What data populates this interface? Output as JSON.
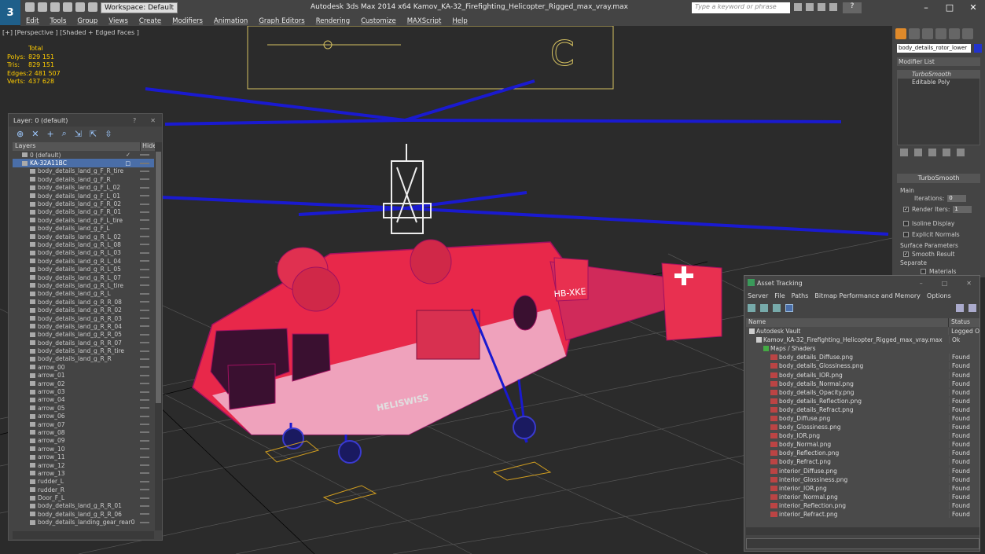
{
  "app": {
    "logo": "3",
    "workspace": "Workspace: Default",
    "title": "Autodesk 3ds Max  2014 x64     Kamov_KA-32_Firefighting_Helicopter_Rigged_max_vray.max",
    "search_placeholder": "Type a keyword or phrase",
    "help": "?",
    "win_min": "–",
    "win_max": "□",
    "win_close": "✕"
  },
  "menu": [
    "Edit",
    "Tools",
    "Group",
    "Views",
    "Create",
    "Modifiers",
    "Animation",
    "Graph Editors",
    "Rendering",
    "Customize",
    "MAXScript",
    "Help"
  ],
  "viewport": {
    "label": "[+] [Perspective ] [Shaded + Edged Faces ]",
    "stats": {
      "header": "Total",
      "rows": [
        {
          "k": "Polys:",
          "v": "829 151"
        },
        {
          "k": "Tris:",
          "v": "829 151"
        },
        {
          "k": "Edges:",
          "v": "2 481 507"
        },
        {
          "k": "Verts:",
          "v": "437 628"
        }
      ]
    },
    "decal_text": "HB-XKE",
    "brand_text": "HELISWISS"
  },
  "layers": {
    "title": "Layer: 0 (default)",
    "help": "?",
    "close": "✕",
    "tools": [
      "⊕",
      "✕",
      "+",
      "⌕",
      "⇲",
      "⇱",
      "⇳"
    ],
    "col_name": "Layers",
    "col_hide": "Hide",
    "rows": [
      {
        "name": "0 (default)",
        "lvl": 1,
        "check": "✓"
      },
      {
        "name": "KA-32A11BC",
        "lvl": 1,
        "sel": true,
        "check": "□"
      },
      {
        "name": "body_details_land_g_F_R_tire",
        "lvl": 2
      },
      {
        "name": "body_details_land_g_F_R",
        "lvl": 2
      },
      {
        "name": "body_details_land_g_F_L_02",
        "lvl": 2
      },
      {
        "name": "body_details_land_g_F_L_01",
        "lvl": 2
      },
      {
        "name": "body_details_land_g_F_R_02",
        "lvl": 2
      },
      {
        "name": "body_details_land_g_F_R_01",
        "lvl": 2
      },
      {
        "name": "body_details_land_g_F_L_tire",
        "lvl": 2
      },
      {
        "name": "body_details_land_g_F_L",
        "lvl": 2
      },
      {
        "name": "body_details_land_g_R_L_02",
        "lvl": 2
      },
      {
        "name": "body_details_land_g_R_L_08",
        "lvl": 2
      },
      {
        "name": "body_details_land_g_R_L_03",
        "lvl": 2
      },
      {
        "name": "body_details_land_g_R_L_04",
        "lvl": 2
      },
      {
        "name": "body_details_land_g_R_L_05",
        "lvl": 2
      },
      {
        "name": "body_details_land_g_R_L_07",
        "lvl": 2
      },
      {
        "name": "body_details_land_g_R_L_tire",
        "lvl": 2
      },
      {
        "name": "body_details_land_g_R_L",
        "lvl": 2
      },
      {
        "name": "body_details_land_g_R_R_08",
        "lvl": 2
      },
      {
        "name": "body_details_land_g_R_R_02",
        "lvl": 2
      },
      {
        "name": "body_details_land_g_R_R_03",
        "lvl": 2
      },
      {
        "name": "body_details_land_g_R_R_04",
        "lvl": 2
      },
      {
        "name": "body_details_land_g_R_R_05",
        "lvl": 2
      },
      {
        "name": "body_details_land_g_R_R_07",
        "lvl": 2
      },
      {
        "name": "body_details_land_g_R_R_tire",
        "lvl": 2
      },
      {
        "name": "body_details_land_g_R_R",
        "lvl": 2
      },
      {
        "name": "arrow_00",
        "lvl": 2
      },
      {
        "name": "arrow_01",
        "lvl": 2
      },
      {
        "name": "arrow_02",
        "lvl": 2
      },
      {
        "name": "arrow_03",
        "lvl": 2
      },
      {
        "name": "arrow_04",
        "lvl": 2
      },
      {
        "name": "arrow_05",
        "lvl": 2
      },
      {
        "name": "arrow_06",
        "lvl": 2
      },
      {
        "name": "arrow_07",
        "lvl": 2
      },
      {
        "name": "arrow_08",
        "lvl": 2
      },
      {
        "name": "arrow_09",
        "lvl": 2
      },
      {
        "name": "arrow_10",
        "lvl": 2
      },
      {
        "name": "arrow_11",
        "lvl": 2
      },
      {
        "name": "arrow_12",
        "lvl": 2
      },
      {
        "name": "arrow_13",
        "lvl": 2
      },
      {
        "name": "rudder_L",
        "lvl": 2
      },
      {
        "name": "rudder_R",
        "lvl": 2
      },
      {
        "name": "Door_F_L",
        "lvl": 2
      },
      {
        "name": "body_details_land_g_R_R_01",
        "lvl": 2
      },
      {
        "name": "body_details_land_g_R_R_06",
        "lvl": 2
      },
      {
        "name": "body_details_landing_gear_rear0",
        "lvl": 2
      }
    ]
  },
  "command_panel": {
    "object_name": "body_details_rotor_lower",
    "object_color": "#2233cc",
    "modifier_list": "Modifier List",
    "stack": [
      "TurboSmooth",
      "Editable Poly"
    ],
    "rollout": "TurboSmooth",
    "main_group": "Main",
    "iterations_label": "Iterations:",
    "iterations_value": "0",
    "render_iters_label": "Render Iters:",
    "render_iters_value": "1",
    "isoline": "Isoline Display",
    "explicit": "Explicit Normals",
    "surface_group": "Surface Parameters",
    "smooth_result": "Smooth Result",
    "separate": "Separate",
    "materials": "Materials"
  },
  "asset_tracking": {
    "title": "Asset Tracking",
    "menu": [
      "Server",
      "File",
      "Paths",
      "Bitmap Performance and Memory",
      "Options"
    ],
    "col_name": "Name",
    "col_status": "Status",
    "rows": [
      {
        "name": "Autodesk Vault",
        "status": "Logged O",
        "icon": "vault",
        "indent": 0
      },
      {
        "name": "Kamov_KA-32_Firefighting_Helicopter_Rigged_max_vray.max",
        "status": "Ok",
        "icon": "max",
        "indent": 1
      },
      {
        "name": "Maps / Shaders",
        "status": "",
        "icon": "folder",
        "indent": 2
      },
      {
        "name": "body_details_Diffuse.png",
        "status": "Found",
        "icon": "png",
        "indent": 3
      },
      {
        "name": "body_details_Glossiness.png",
        "status": "Found",
        "icon": "png",
        "indent": 3
      },
      {
        "name": "body_details_IOR.png",
        "status": "Found",
        "icon": "png",
        "indent": 3
      },
      {
        "name": "body_details_Normal.png",
        "status": "Found",
        "icon": "png",
        "indent": 3
      },
      {
        "name": "body_details_Opacity.png",
        "status": "Found",
        "icon": "png",
        "indent": 3
      },
      {
        "name": "body_details_Reflection.png",
        "status": "Found",
        "icon": "png",
        "indent": 3
      },
      {
        "name": "body_details_Refract.png",
        "status": "Found",
        "icon": "png",
        "indent": 3
      },
      {
        "name": "body_Diffuse.png",
        "status": "Found",
        "icon": "png",
        "indent": 3
      },
      {
        "name": "body_Glossiness.png",
        "status": "Found",
        "icon": "png",
        "indent": 3
      },
      {
        "name": "body_IOR.png",
        "status": "Found",
        "icon": "png",
        "indent": 3
      },
      {
        "name": "body_Normal.png",
        "status": "Found",
        "icon": "png",
        "indent": 3
      },
      {
        "name": "body_Reflection.png",
        "status": "Found",
        "icon": "png",
        "indent": 3
      },
      {
        "name": "body_Refract.png",
        "status": "Found",
        "icon": "png",
        "indent": 3
      },
      {
        "name": "interior_Diffuse.png",
        "status": "Found",
        "icon": "png",
        "indent": 3
      },
      {
        "name": "interior_Glossiness.png",
        "status": "Found",
        "icon": "png",
        "indent": 3
      },
      {
        "name": "interior_IOR.png",
        "status": "Found",
        "icon": "png",
        "indent": 3
      },
      {
        "name": "interior_Normal.png",
        "status": "Found",
        "icon": "png",
        "indent": 3
      },
      {
        "name": "interior_Reflection.png",
        "status": "Found",
        "icon": "png",
        "indent": 3
      },
      {
        "name": "interior_Refract.png",
        "status": "Found",
        "icon": "png",
        "indent": 3
      }
    ]
  }
}
